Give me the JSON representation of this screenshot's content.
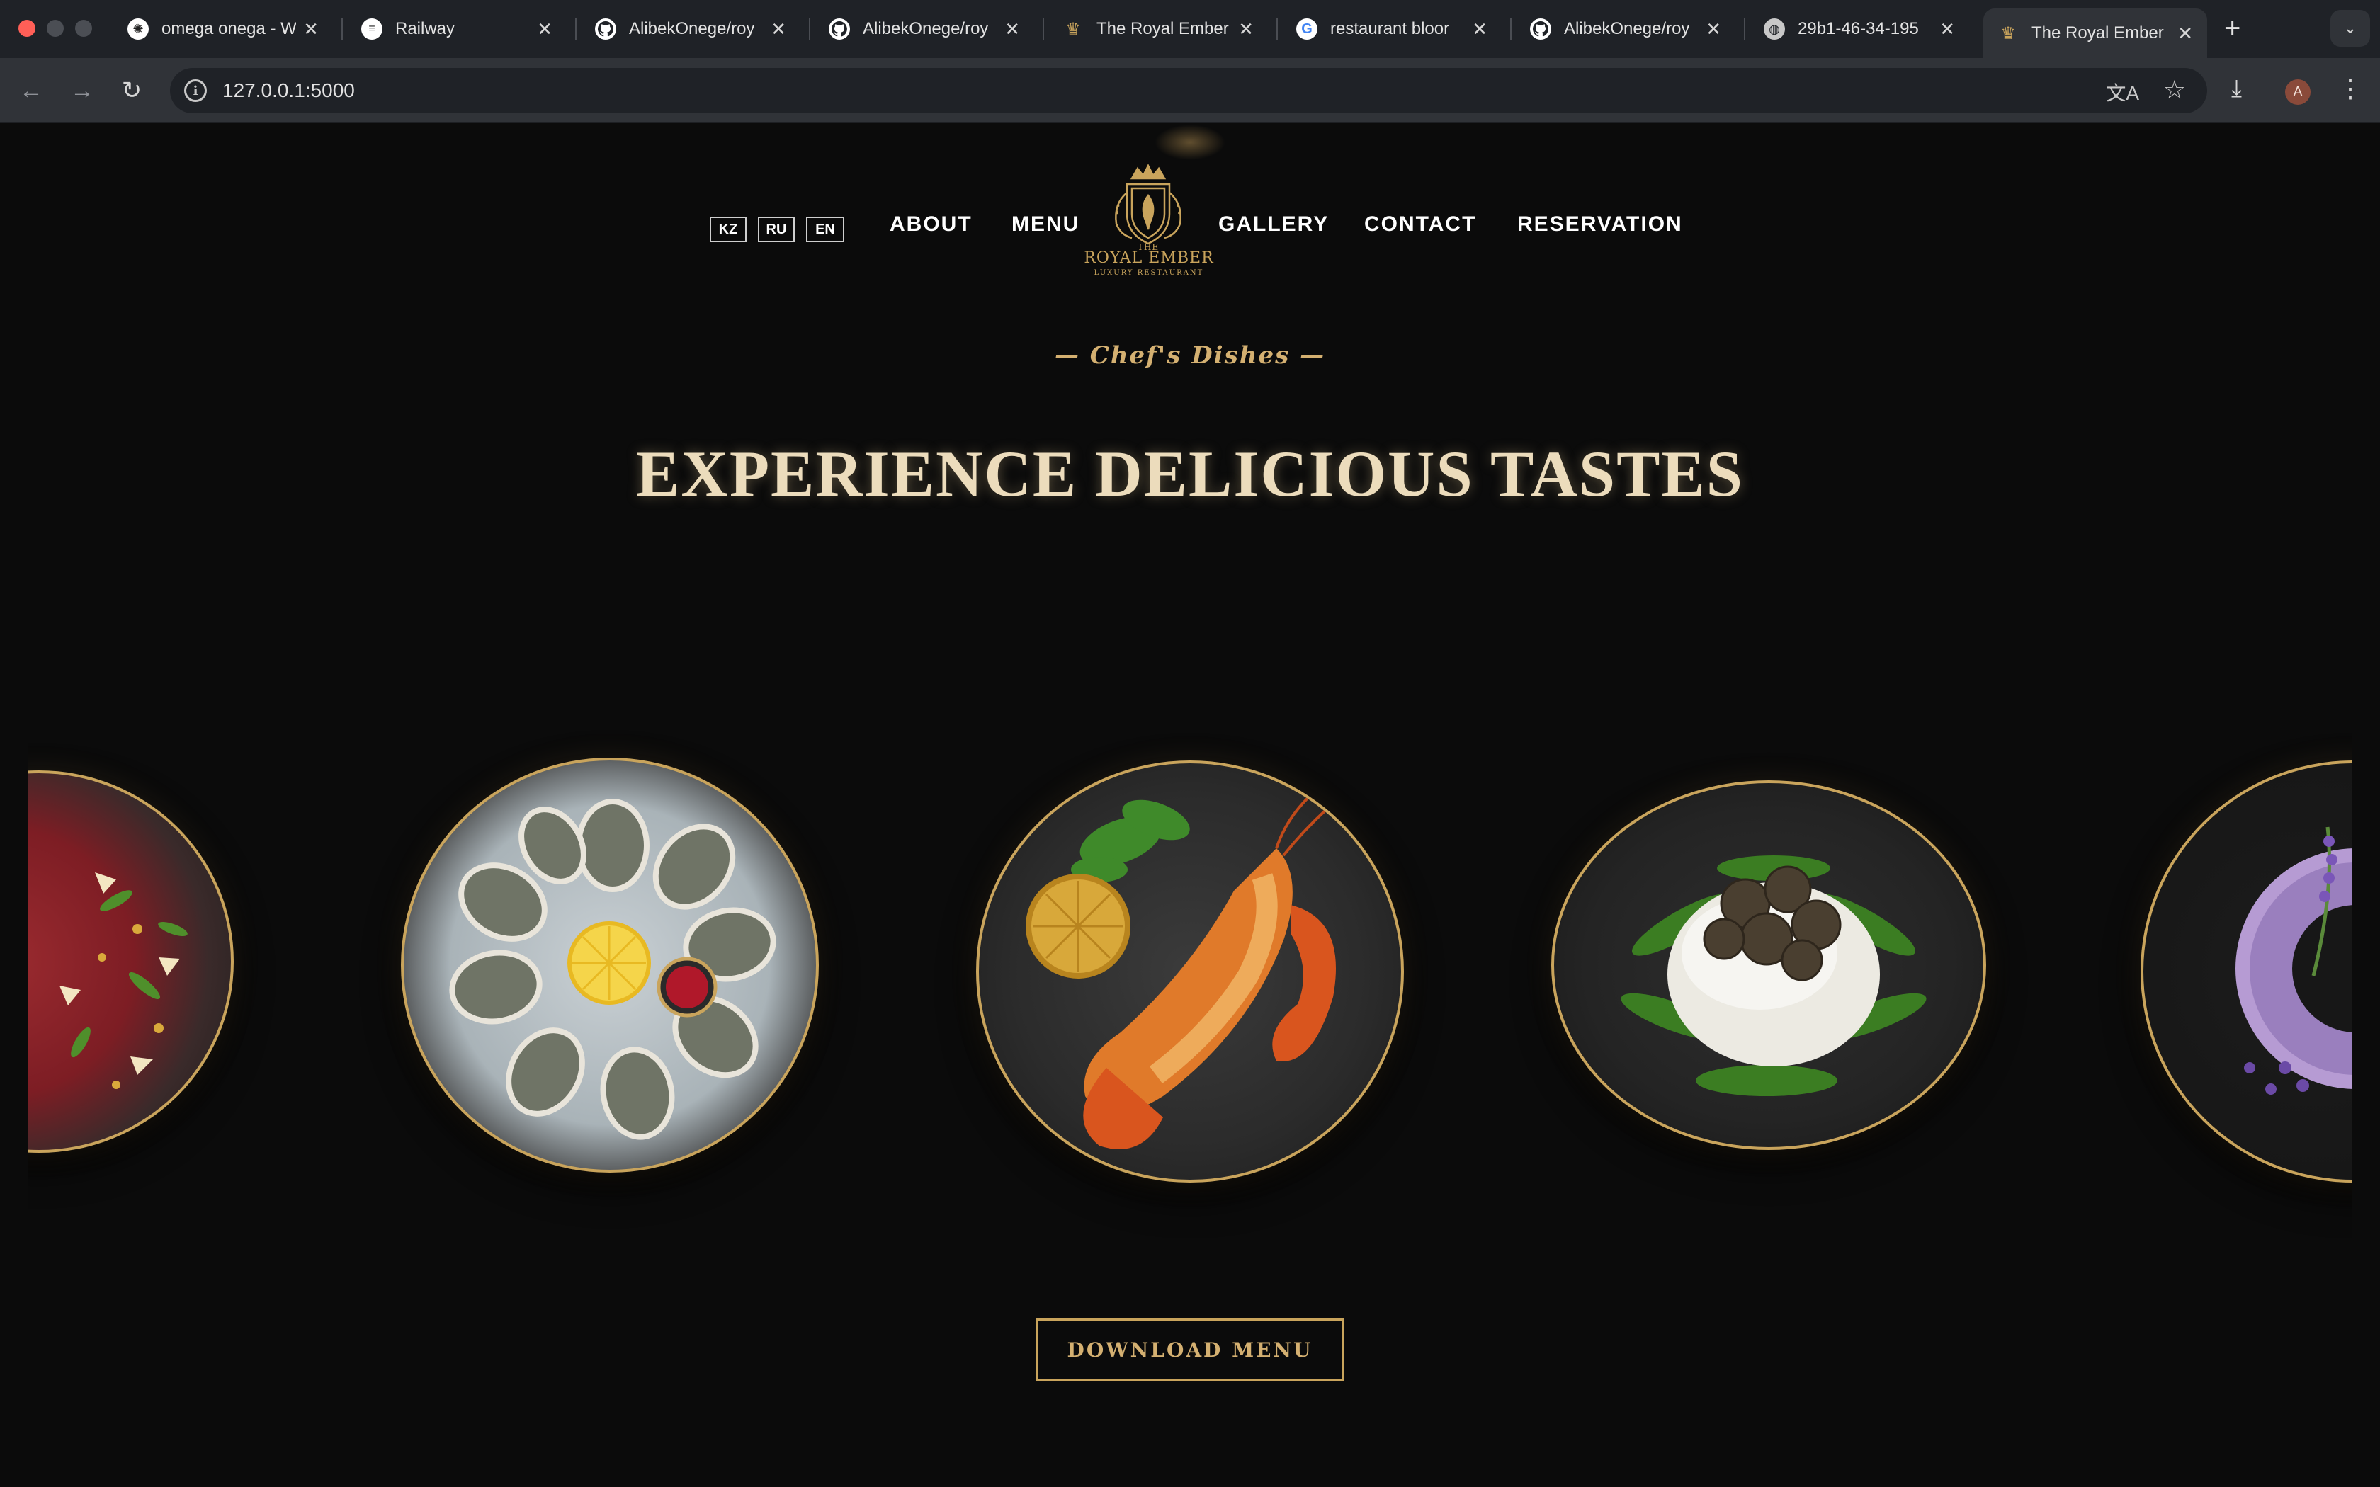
{
  "browser": {
    "tabs": [
      {
        "title": "omega onega - W",
        "icon": "openai-icon"
      },
      {
        "title": "Railway",
        "icon": "railway-icon"
      },
      {
        "title": "AlibekOnege/roy",
        "icon": "github-icon"
      },
      {
        "title": "AlibekOnege/roy",
        "icon": "github-icon"
      },
      {
        "title": "The Royal Ember",
        "icon": "crest-icon"
      },
      {
        "title": "restaurant bloor",
        "icon": "google-icon"
      },
      {
        "title": "AlibekOnege/roy",
        "icon": "github-icon"
      },
      {
        "title": "29b1-46-34-195",
        "icon": "globe-icon"
      },
      {
        "title": "The Royal Ember",
        "icon": "crest-icon",
        "active": true
      }
    ],
    "url": "127.0.0.1:5000",
    "avatar_letter": "A"
  },
  "site": {
    "languages": [
      "KZ",
      "RU",
      "EN"
    ],
    "nav_left": [
      "ABOUT",
      "MENU"
    ],
    "nav_right": [
      "GALLERY",
      "CONTACT",
      "RESERVATION"
    ],
    "logo": {
      "the": "THE",
      "name": "ROYAL EMBER",
      "tagline": "LUXURY RESTAURANT"
    },
    "eyebrow": "— Chef's Dishes —",
    "headline": "EXPERIENCE DELICIOUS TASTES",
    "cta": "DOWNLOAD MENU",
    "dishes": [
      {
        "name": "carpaccio-dish"
      },
      {
        "name": "oysters-dish"
      },
      {
        "name": "lobster-dish"
      },
      {
        "name": "burrata-truffle-dish"
      },
      {
        "name": "lavender-dessert-dish"
      }
    ]
  },
  "colors": {
    "gold": "#c9a45c",
    "background": "#0b0b0b",
    "headline": "#ecdcbc"
  }
}
